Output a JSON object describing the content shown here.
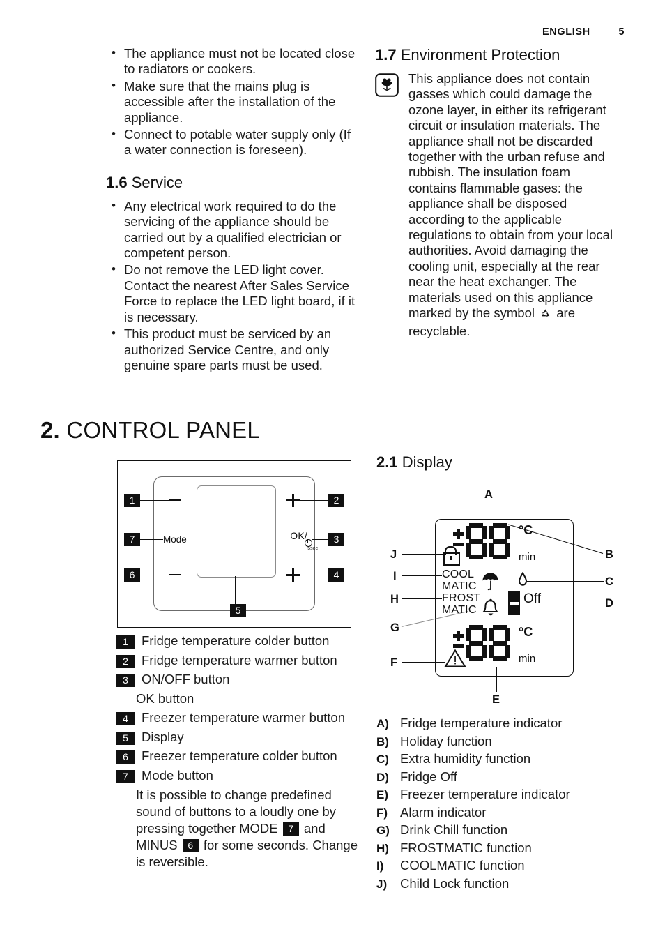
{
  "header": {
    "language": "ENGLISH",
    "page_number": "5"
  },
  "left_column": {
    "top_bullets": [
      "The appliance must not be located close to radiators or cookers.",
      "Make sure that the mains plug is accessible after the installation of the appliance.",
      "Connect to potable water supply only (If a water connection is foreseen)."
    ],
    "service_heading_number": "1.6",
    "service_heading_title": "Service",
    "service_bullets": [
      "Any electrical work required to do the servicing of the appliance should be carried out by a qualified electrician or competent person.",
      "Do not remove the LED light cover. Contact the nearest After Sales Service Force to replace the LED light board, if it is necessary.",
      "This product must be serviced by an authorized Service Centre, and only genuine spare parts must be used."
    ]
  },
  "right_column": {
    "env_heading_number": "1.7",
    "env_heading_title": "Environment Protection",
    "env_icon": "tulip-icon",
    "env_text_before_symbol": "This appliance does not contain gasses which could damage the ozone layer, in either its refrigerant circuit or insulation materials. The appliance shall not be discarded together with the urban refuse and rubbish. The insulation foam contains flammable gases: the appliance shall be disposed according to the applicable regulations to obtain from your local authorities. Avoid damaging the cooling unit, especially at the rear near the heat exchanger. The materials used on this appliance marked by the symbol",
    "env_symbol_name": "recycling-icon",
    "env_text_after_symbol": "are recyclable."
  },
  "chapter": {
    "number": "2.",
    "title": "CONTROL PANEL"
  },
  "control_panel": {
    "callouts": [
      "1",
      "2",
      "3",
      "4",
      "5",
      "6",
      "7"
    ],
    "minus_symbol": "−",
    "plus_symbol": "+",
    "mode_label": "Mode",
    "ok_label": "OK/",
    "ok_seconds": "5sec",
    "power_icon": "power-icon"
  },
  "control_legend": {
    "items": [
      {
        "badge": "1",
        "label": "Fridge temperature colder button"
      },
      {
        "badge": "2",
        "label": "Fridge temperature warmer button"
      },
      {
        "badge": "3",
        "label": "ON/OFF button",
        "sub_label": "OK button"
      },
      {
        "badge": "4",
        "label": "Freezer temperature warmer button"
      },
      {
        "badge": "5",
        "label": "Display"
      },
      {
        "badge": "6",
        "label": "Freezer temperature colder button"
      },
      {
        "badge": "7",
        "label": "Mode button"
      }
    ],
    "note_part1": "It is possible to change predefined sound of buttons to a loudly one by pressing together MODE",
    "note_badge1": "7",
    "note_part2": "and MINUS",
    "note_badge2": "6",
    "note_part3": "for some seconds. Change is reversible."
  },
  "display_section": {
    "heading_number": "2.1",
    "heading_title": "Display",
    "callout_letters": [
      "A",
      "B",
      "C",
      "D",
      "E",
      "F",
      "G",
      "H",
      "I",
      "J"
    ],
    "lcd": {
      "unit_celsius": "°C",
      "unit_min": "min",
      "off_label": "Off",
      "coolmatic_line1": "COOL",
      "coolmatic_line2": "MATIC",
      "frostmatic_line1": "FROST",
      "frostmatic_line2": "MATIC",
      "digits_top": "88",
      "digits_bottom": "88",
      "icons": [
        "child-lock-icon",
        "umbrella-icon",
        "water-drop-icon",
        "fridge-off-icon",
        "bell-icon",
        "warning-triangle-icon",
        "plus-minus-icon"
      ]
    },
    "legend": [
      {
        "key": "A)",
        "label": "Fridge temperature indicator"
      },
      {
        "key": "B)",
        "label": "Holiday function"
      },
      {
        "key": "C)",
        "label": "Extra humidity function"
      },
      {
        "key": "D)",
        "label": "Fridge Off"
      },
      {
        "key": "E)",
        "label": "Freezer temperature indicator"
      },
      {
        "key": "F)",
        "label": "Alarm indicator"
      },
      {
        "key": "G)",
        "label": "Drink Chill function"
      },
      {
        "key": "H)",
        "label": "FROSTMATIC function"
      },
      {
        "key": "I)",
        "label": "COOLMATIC function"
      },
      {
        "key": "J)",
        "label": "Child Lock function"
      }
    ]
  }
}
